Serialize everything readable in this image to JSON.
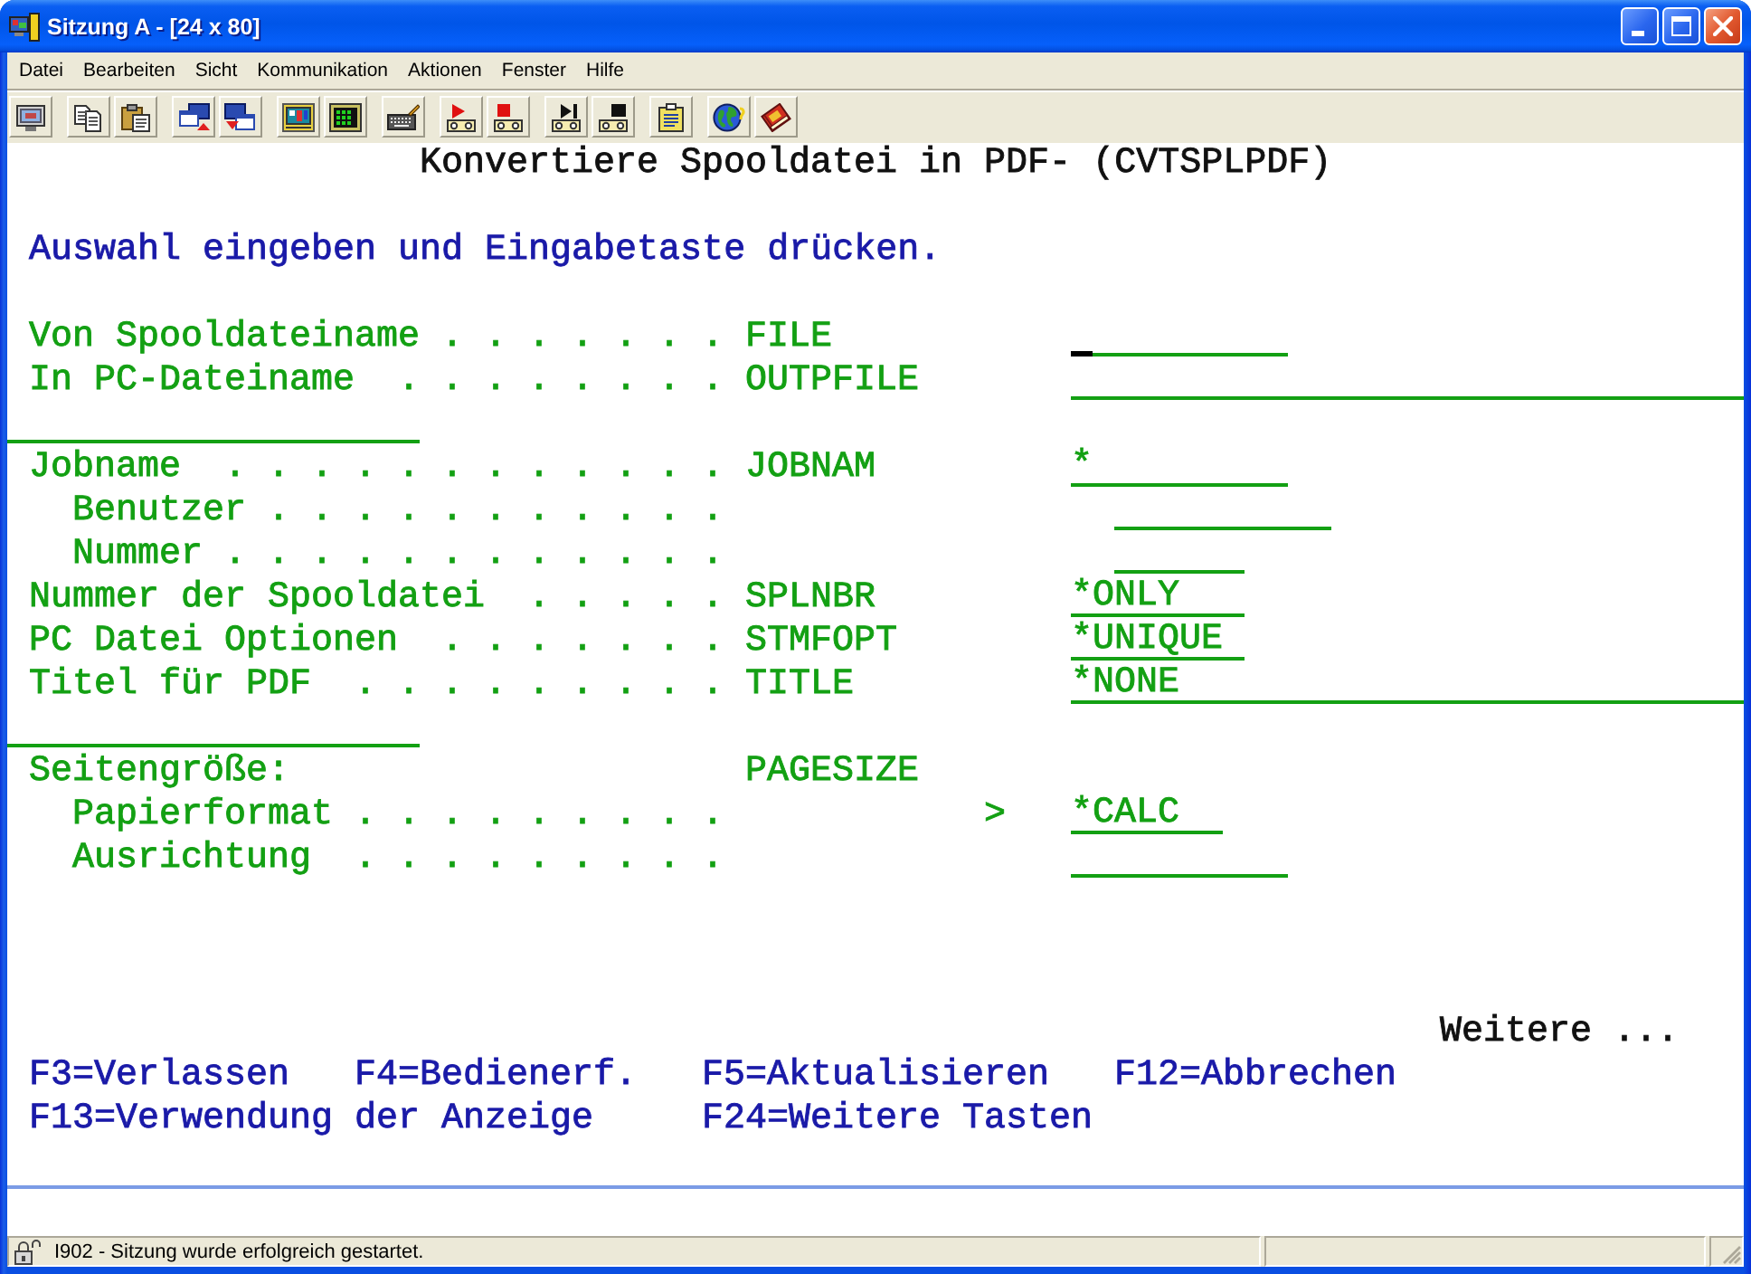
{
  "window": {
    "title": "Sitzung A - [24 x 80]"
  },
  "menu": [
    {
      "label": "Datei"
    },
    {
      "label": "Bearbeiten"
    },
    {
      "label": "Sicht"
    },
    {
      "label": "Kommunikation"
    },
    {
      "label": "Aktionen"
    },
    {
      "label": "Fenster"
    },
    {
      "label": "Hilfe"
    }
  ],
  "screen": {
    "title": "Konvertiere Spooldatei in PDF- (CVTSPLPDF)",
    "instruction": "Auswahl eingeben und Eingabetaste drücken.",
    "parameters": [
      {
        "label": "Von Spooldateiname . . . . . . .",
        "keyword": "FILE",
        "field": {
          "cursor": true
        }
      },
      {
        "label": "In PC-Dateiname  . . . . . . . .",
        "keyword": "OUTPFILE",
        "field": {
          "cursor": false
        }
      },
      {
        "label": "Jobname  . . . . . . . . . . . .",
        "keyword": "JOBNAM",
        "field": {
          "value": "*",
          "cursor": false
        },
        "children": [
          {
            "label": "Benutzer . . . . . . . . . . .",
            "field": {
              "cursor": false
            }
          },
          {
            "label": "Nummer . . . . . . . . . . . .",
            "field": {
              "cursor": false
            }
          }
        ]
      },
      {
        "label": "Nummer der Spooldatei  . . . . .",
        "keyword": "SPLNBR",
        "field": {
          "value": "*ONLY",
          "cursor": false
        }
      },
      {
        "label": "PC Datei Optionen  . . . . . . .",
        "keyword": "STMFOPT",
        "field": {
          "value": "*UNIQUE",
          "cursor": false
        }
      },
      {
        "label": "Titel für PDF  . . . . . . . . .",
        "keyword": "TITLE",
        "field": {
          "value": "*NONE",
          "cursor": false
        }
      },
      {
        "label": "Seitengröße:",
        "keyword": "PAGESIZE",
        "children": [
          {
            "label": "Papierformat . . . . . . . . .",
            "marker": ">",
            "field": {
              "value": "*CALC",
              "cursor": false
            }
          },
          {
            "label": "Ausrichtung  . . . . . . . . .",
            "field": {
              "cursor": false
            }
          }
        ]
      }
    ],
    "more": "Weitere ...",
    "function_keys": [
      [
        "F3=Verlassen",
        "F4=Bedienerf.",
        "F5=Aktualisieren",
        "F12=Abbrechen"
      ],
      [
        "F13=Verwendung der Anzeige",
        "F24=Weitere Tasten"
      ]
    ]
  },
  "status_bar": {
    "message": "I902 - Sitzung wurde erfolgreich gestartet."
  }
}
